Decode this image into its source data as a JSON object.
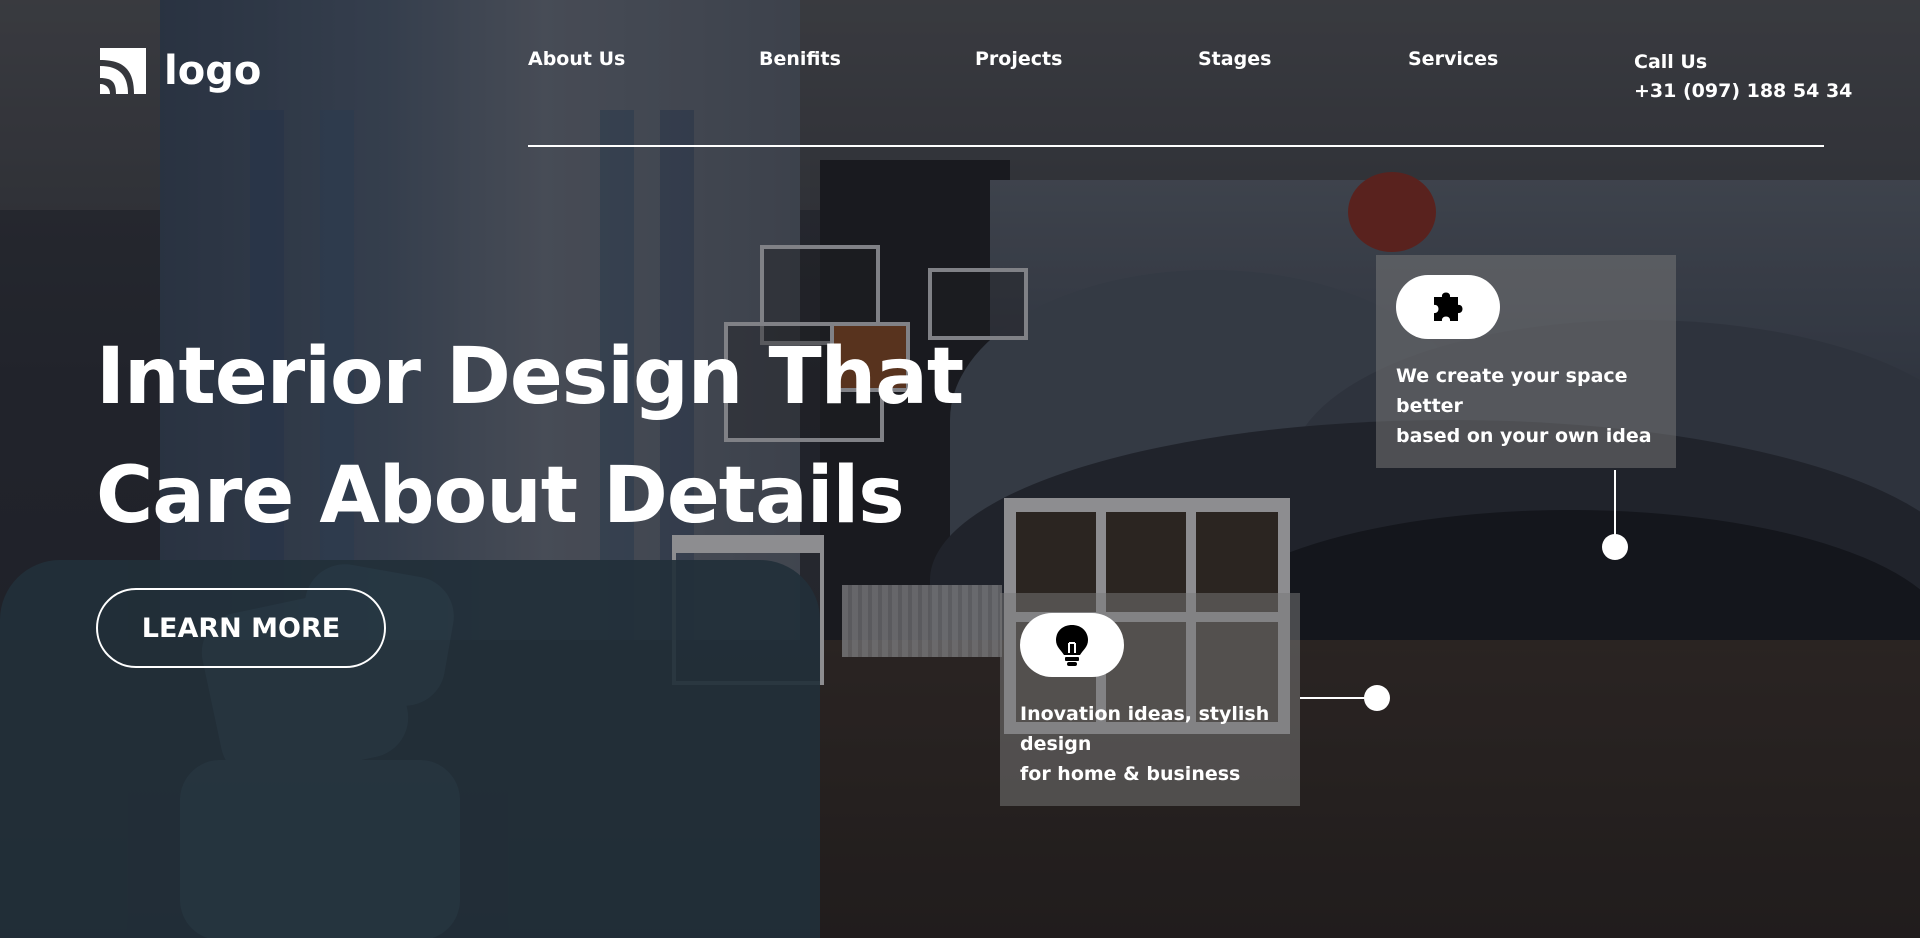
{
  "header": {
    "logo_text": "logo",
    "nav": [
      {
        "label": "About Us"
      },
      {
        "label": "Benifits"
      },
      {
        "label": "Projects"
      },
      {
        "label": "Stages"
      },
      {
        "label": "Services"
      }
    ],
    "call": {
      "label": "Call Us",
      "phone": "+31 (097) 188 54 34"
    }
  },
  "hero": {
    "headline_line1": "Interior Design That",
    "headline_line2": "Care About Details",
    "cta_label": "LEARN MORE"
  },
  "features": [
    {
      "icon": "puzzle-icon",
      "lines": [
        "We create your space",
        "better",
        "based on your own idea"
      ]
    },
    {
      "icon": "lightbulb-icon",
      "lines": [
        "Inovation ideas, stylish",
        "design",
        "for home & business"
      ]
    }
  ],
  "colors": {
    "text": "#ffffff",
    "card_bg": "rgba(120,120,120,0.52)",
    "accent": "#ffffff"
  }
}
